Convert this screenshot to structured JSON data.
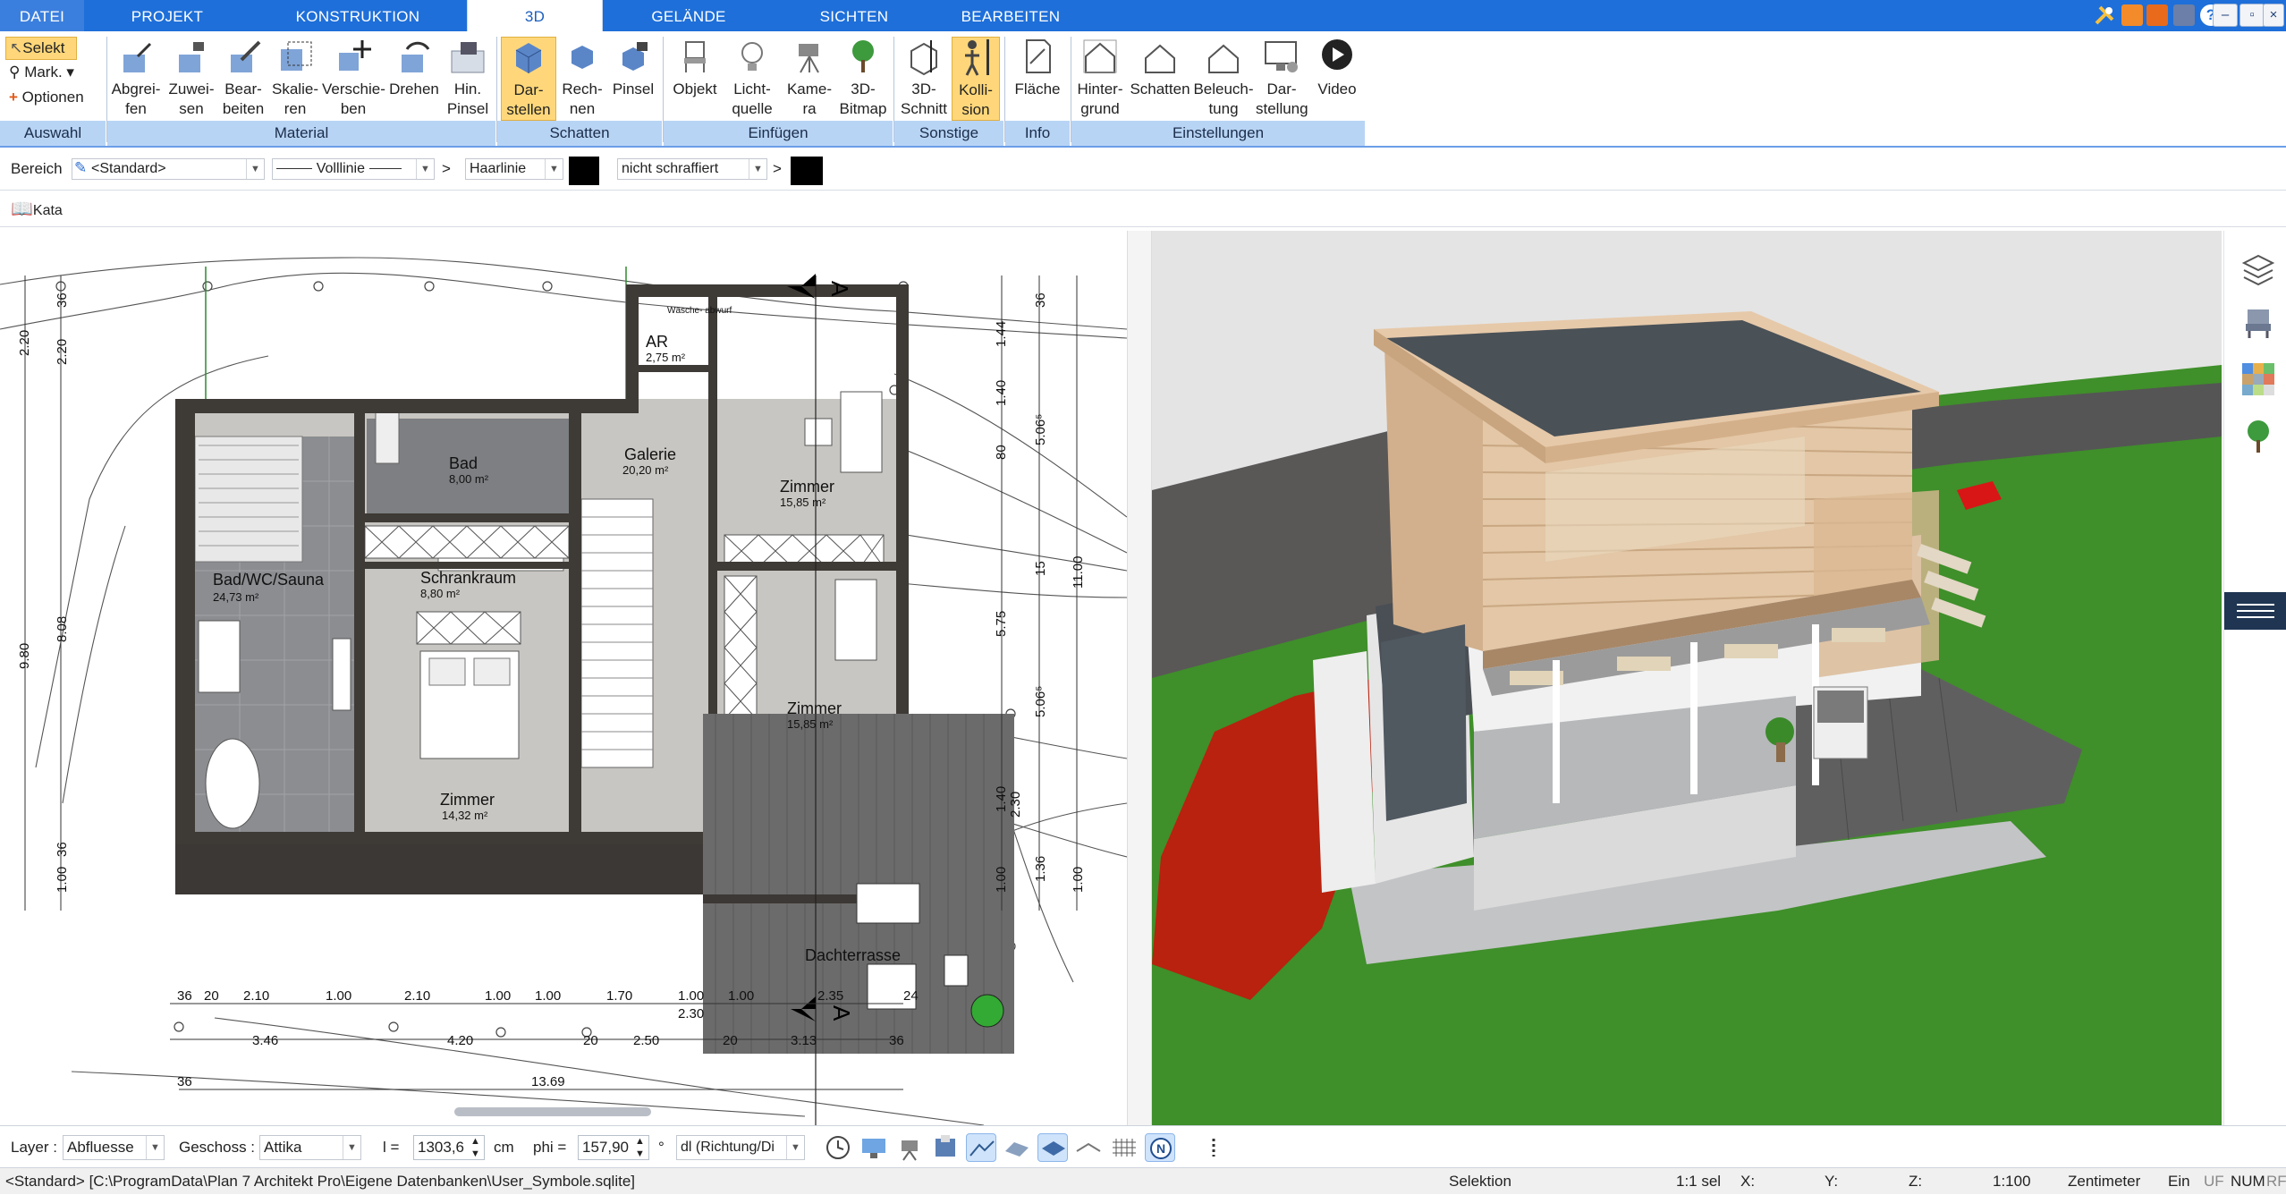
{
  "tabs": [
    "DATEI",
    "PROJEKT",
    "KONSTRUKTION",
    "3D",
    "GELÄNDE",
    "SICHTEN",
    "BEARBEITEN"
  ],
  "active_tab": "3D",
  "ribbon": {
    "auswahl": {
      "select_label": "Selekt",
      "mark_label": "Mark.",
      "options_label": "Optionen",
      "group": "Auswahl"
    },
    "material": {
      "buttons": [
        "Abgrei-\nfen",
        "Zuwei-\nsen",
        "Bear-\nbeiten",
        "Skalie-\nren",
        "Verschie-\nben",
        "Drehen",
        "Hin.\nPinsel"
      ],
      "group": "Material"
    },
    "schatten": {
      "buttons": [
        "Dar-\nstellen",
        "Rech-\nnen",
        "Pinsel"
      ],
      "group": "Schatten"
    },
    "einfuegen": {
      "buttons": [
        "Objekt",
        "Licht-\nquelle",
        "Kame-\nra",
        "3D-\nBitmap"
      ],
      "group": "Einfügen"
    },
    "sonstige": {
      "buttons": [
        "3D-\nSchnitt",
        "Kolli-\nsion"
      ],
      "group": "Sonstige"
    },
    "info": {
      "buttons": [
        "Fläche"
      ],
      "group": "Info"
    },
    "einstellungen": {
      "buttons": [
        "Hinter-\ngrund",
        "Schatten",
        "Beleuch-\ntung",
        "Dar-\nstellung",
        "Video"
      ],
      "group": "Einstellungen"
    }
  },
  "props": {
    "bereich_label": "Bereich",
    "bereich_value": "<Standard>",
    "line_value": "Volllinie",
    "arrow": ">",
    "thickness_value": "Haarlinie",
    "hatch_value": "nicht schraffiert",
    "catalog_label": "Kata"
  },
  "plan": {
    "rooms": [
      {
        "name": "Bad/WC/Sauna",
        "area": "24,73 m²"
      },
      {
        "name": "Bad",
        "area": "8,00 m²"
      },
      {
        "name": "Schrankraum",
        "area": "8,80 m²"
      },
      {
        "name": "Zimmer",
        "area": "14,32 m²"
      },
      {
        "name": "Galerie",
        "area": "20,20 m²"
      },
      {
        "name": "AR",
        "area": "2,75 m²"
      },
      {
        "name": "Zimmer",
        "area": "15,85 m²"
      },
      {
        "name": "Zimmer",
        "area": "15,85 m²"
      },
      {
        "name": "Dachterrasse",
        "area": ""
      }
    ],
    "laundry": "Wäsche-\nabwurf",
    "section_marker": "A",
    "dims_bottom_row1": [
      "36",
      "20",
      "2.10",
      "1.00",
      "2.10",
      "1.00",
      "1.00",
      "1.70",
      "1.00",
      "1.00",
      "24"
    ],
    "dims_bottom_row2": [
      "3.46",
      "4.20",
      "20",
      "2.50",
      "20",
      "3.13",
      "36"
    ],
    "dims_bottom_extra": [
      "2.35",
      "2.30"
    ],
    "dims_bottom_total": [
      "36",
      "13.69"
    ],
    "dims_left": [
      "36",
      "2.20",
      "2.20",
      "8.08",
      "9.80",
      "36",
      "1.00"
    ],
    "dims_right": [
      "36",
      "1.44",
      "1.40",
      "80",
      "5.06⁵",
      "15",
      "11.00",
      "5.75",
      "5.06⁵",
      "1.40",
      "2.30",
      "1.00",
      "1.36",
      "1.00"
    ]
  },
  "statusbar": {
    "layer_label": "Layer :",
    "layer_value": "Abfluesse",
    "geschoss_label": "Geschoss :",
    "geschoss_value": "Attika",
    "l_label": "l =",
    "l_value": "1303,6",
    "l_unit": "cm",
    "phi_label": "phi =",
    "phi_value": "157,90",
    "phi_unit": "°",
    "dl_value": "dl (Richtung/Di",
    "path": "<Standard>  [C:\\ProgramData\\Plan 7 Architekt Pro\\Eigene Datenbanken\\User_Symbole.sqlite]",
    "mode": "Selektion",
    "scale_sel": "1:1 sel",
    "x_label": "X:",
    "y_label": "Y:",
    "z_label": "Z:",
    "scale": "1:100",
    "unit": "Zentimeter",
    "ein": "Ein",
    "uf": "UF",
    "num": "NUM",
    "rf": "RF"
  },
  "colors": {
    "tabbar": "#1e6fd9",
    "group_bar": "#b8d4f5",
    "selected_btn": "#ffd77a",
    "grass": "#3f8f2a",
    "roof": "#4a5157",
    "wood": "#d2b08d",
    "red_zone": "#b8220f"
  }
}
